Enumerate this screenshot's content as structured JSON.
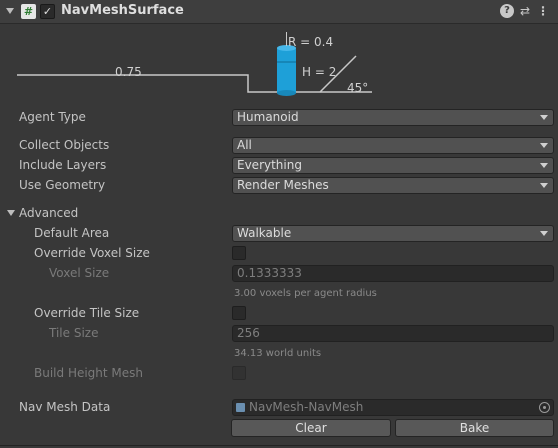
{
  "component": {
    "title": "NavMeshSurface",
    "enabled_mark": "✓",
    "script_glyph": "#",
    "icons": {
      "help": "?",
      "preset": "⇄",
      "menu": "⋮"
    }
  },
  "diagram": {
    "radius_label": "R = 0.4",
    "height_label": "H = 2",
    "step_label": "0.75",
    "slope_label": "45°",
    "colors": {
      "agent": "#1ea0d8",
      "lines": "#c8c8c8"
    }
  },
  "fields": {
    "agent_type": {
      "label": "Agent Type",
      "value": "Humanoid"
    },
    "collect_objects": {
      "label": "Collect Objects",
      "value": "All"
    },
    "include_layers": {
      "label": "Include Layers",
      "value": "Everything"
    },
    "use_geometry": {
      "label": "Use Geometry",
      "value": "Render Meshes"
    }
  },
  "advanced": {
    "label": "Advanced",
    "default_area": {
      "label": "Default Area",
      "value": "Walkable"
    },
    "override_voxel_size": {
      "label": "Override Voxel Size",
      "checked": false
    },
    "voxel_size": {
      "label": "Voxel Size",
      "value": "0.1333333",
      "hint": "3.00 voxels per agent radius"
    },
    "override_tile_size": {
      "label": "Override Tile Size",
      "checked": false
    },
    "tile_size": {
      "label": "Tile Size",
      "value": "256",
      "hint": "34.13 world units"
    },
    "build_height_mesh": {
      "label": "Build Height Mesh",
      "checked": false
    }
  },
  "nav_mesh_data": {
    "label": "Nav Mesh Data",
    "value": "NavMesh-NavMesh"
  },
  "buttons": {
    "clear": "Clear",
    "bake": "Bake"
  }
}
